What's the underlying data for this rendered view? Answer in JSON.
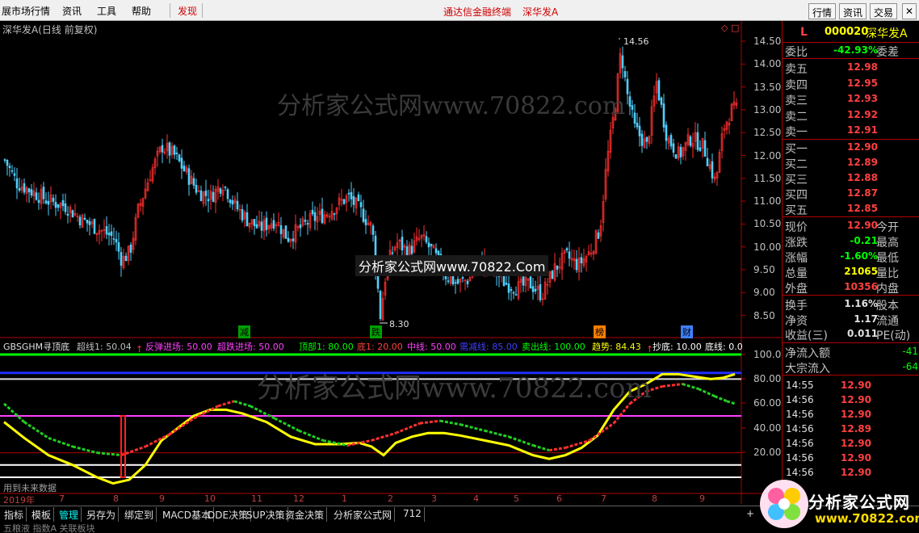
{
  "menu": {
    "items": [
      "展市场行情",
      "资讯",
      "工具",
      "帮助",
      "发现"
    ],
    "center_title": "通达信金融终端",
    "center_stock": "深华发A",
    "right_buttons": [
      "行情",
      "资讯",
      "交易"
    ]
  },
  "chart": {
    "title": "深华发A(日线 前复权)",
    "price_ticks": [
      "14.50",
      "14.00",
      "13.50",
      "13.00",
      "12.50",
      "12.00",
      "11.50",
      "11.00",
      "10.50",
      "10.00",
      "9.50",
      "9.00",
      "8.50"
    ],
    "high_label": "14.56",
    "low_label": "8.30",
    "event_markers": [
      {
        "label": "减",
        "color": "#00c000"
      },
      {
        "label": "跌",
        "color": "#00c000"
      },
      {
        "label": "榜",
        "color": "#ff8000"
      },
      {
        "label": "财",
        "color": "#4080ff"
      }
    ],
    "watermark_top": "分析家公式网www.70822.com",
    "watermark_mid": "分析家公式网www.70822.Com",
    "watermark_ind": "分析家公式网www.70822.com"
  },
  "indicator": {
    "name": "GBSGHM寻顶底",
    "params": [
      {
        "text": "超线1: 50.04",
        "color": "#c0c0c0"
      },
      {
        "text": "反弹进场: 50.00",
        "color": "#ff40ff"
      },
      {
        "text": "超跌进场: 50.00",
        "color": "#ff40ff"
      },
      {
        "text": "顶部1: 80.00",
        "color": "#00ff00"
      },
      {
        "text": "底1: 20.00",
        "color": "#ff4040"
      },
      {
        "text": "中线: 50.00",
        "color": "#ff40ff"
      },
      {
        "text": "需减线: 85.00",
        "color": "#4040ff"
      },
      {
        "text": "卖出线: 100.00",
        "color": "#00ff00"
      },
      {
        "text": "趋势: 84.43",
        "color": "#ffff00"
      },
      {
        "text": "抄底: 10.00",
        "color": "#ffffff"
      },
      {
        "text": "底线: 0.0",
        "color": "#ffffff"
      }
    ],
    "y_ticks": [
      "100.00",
      "80.00",
      "60.00",
      "40.00",
      "20.00"
    ],
    "footer_note": "用到未来数据"
  },
  "xaxis": {
    "labels": [
      "2019年",
      "7",
      "8",
      "9",
      "10",
      "11",
      "12",
      "1",
      "2",
      "3",
      "4",
      "5",
      "6",
      "7",
      "8",
      "9"
    ]
  },
  "quote": {
    "market": "L",
    "code": "000020",
    "name": "深华发A",
    "weibi_label": "委比",
    "weibi": "-42.93%",
    "weicha_label": "委差",
    "asks": [
      {
        "label": "卖五",
        "price": "12.98"
      },
      {
        "label": "卖四",
        "price": "12.95"
      },
      {
        "label": "卖三",
        "price": "12.93"
      },
      {
        "label": "卖二",
        "price": "12.92"
      },
      {
        "label": "卖一",
        "price": "12.91"
      }
    ],
    "bids": [
      {
        "label": "买一",
        "price": "12.90"
      },
      {
        "label": "买二",
        "price": "12.89"
      },
      {
        "label": "买三",
        "price": "12.88"
      },
      {
        "label": "买四",
        "price": "12.87"
      },
      {
        "label": "买五",
        "price": "12.85"
      }
    ],
    "stats": [
      {
        "k": "现价",
        "v": "12.90",
        "vc": "#ff4040",
        "k2": "今开"
      },
      {
        "k": "涨跌",
        "v": "-0.21",
        "vc": "#00ff00",
        "k2": "最高"
      },
      {
        "k": "涨幅",
        "v": "-1.60%",
        "vc": "#00ff00",
        "k2": "最低"
      },
      {
        "k": "总量",
        "v": "21065",
        "vc": "#ffff00",
        "k2": "量比"
      },
      {
        "k": "外盘",
        "v": "10356",
        "vc": "#ff4040",
        "k2": "内盘"
      }
    ],
    "fin": [
      {
        "k": "换手",
        "v": "1.16%",
        "k2": "股本"
      },
      {
        "k": "净资",
        "v": "1.17",
        "k2": "流通"
      },
      {
        "k": "收益(三)",
        "v": "0.011",
        "k2": "PE(动)"
      }
    ],
    "flows": [
      {
        "k": "净流入额",
        "v": "-41"
      },
      {
        "k": "大宗流入",
        "v": "-64"
      }
    ],
    "ticks": [
      {
        "time": "14:55",
        "price": "12.90"
      },
      {
        "time": "14:56",
        "price": "12.90"
      },
      {
        "time": "14:56",
        "price": "12.90"
      },
      {
        "time": "14:56",
        "price": "12.89"
      },
      {
        "time": "14:56",
        "price": "12.90"
      },
      {
        "time": "14:56",
        "price": "12.90"
      },
      {
        "time": "14:56",
        "price": "12.90"
      }
    ]
  },
  "tabs": [
    "指标",
    "模板",
    "管理",
    "另存为",
    "绑定到",
    "MACD基本",
    "DDE决策",
    "SUP决策",
    "资金决策",
    "分析家公式网",
    "712"
  ],
  "bottom_text": "五粮液  指数A  关联板块",
  "logo": {
    "line1": "分析家公式网",
    "line2": "www.70822.com"
  },
  "colors": {
    "up": "#ff3030",
    "down": "#50d0ff",
    "axis": "#b00000",
    "price_yellow": "#ffff00"
  }
}
